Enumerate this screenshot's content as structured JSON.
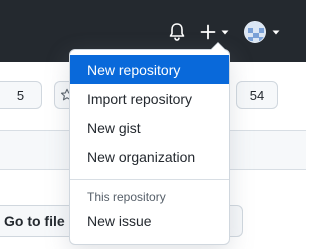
{
  "header": {
    "icons": {
      "notifications": "bell-icon",
      "create": "plus-icon",
      "create_caret": "caret-down-icon",
      "avatar": "avatar",
      "avatar_caret": "caret-down-icon"
    },
    "colors": {
      "background": "#24292f",
      "icon": "#ffffff"
    }
  },
  "repo_bar": {
    "watch_count": "5",
    "star_count": "54",
    "star_icon": "star-icon"
  },
  "code_area": {
    "goto_file_label": "Go to file"
  },
  "create_menu": {
    "items": [
      {
        "label": "New repository",
        "active": true
      },
      {
        "label": "Import repository"
      },
      {
        "label": "New gist"
      },
      {
        "label": "New organization"
      }
    ],
    "section_label": "This repository",
    "section_items": [
      {
        "label": "New issue"
      }
    ],
    "colors": {
      "active_bg": "#0969da",
      "active_text": "#ffffff"
    }
  }
}
